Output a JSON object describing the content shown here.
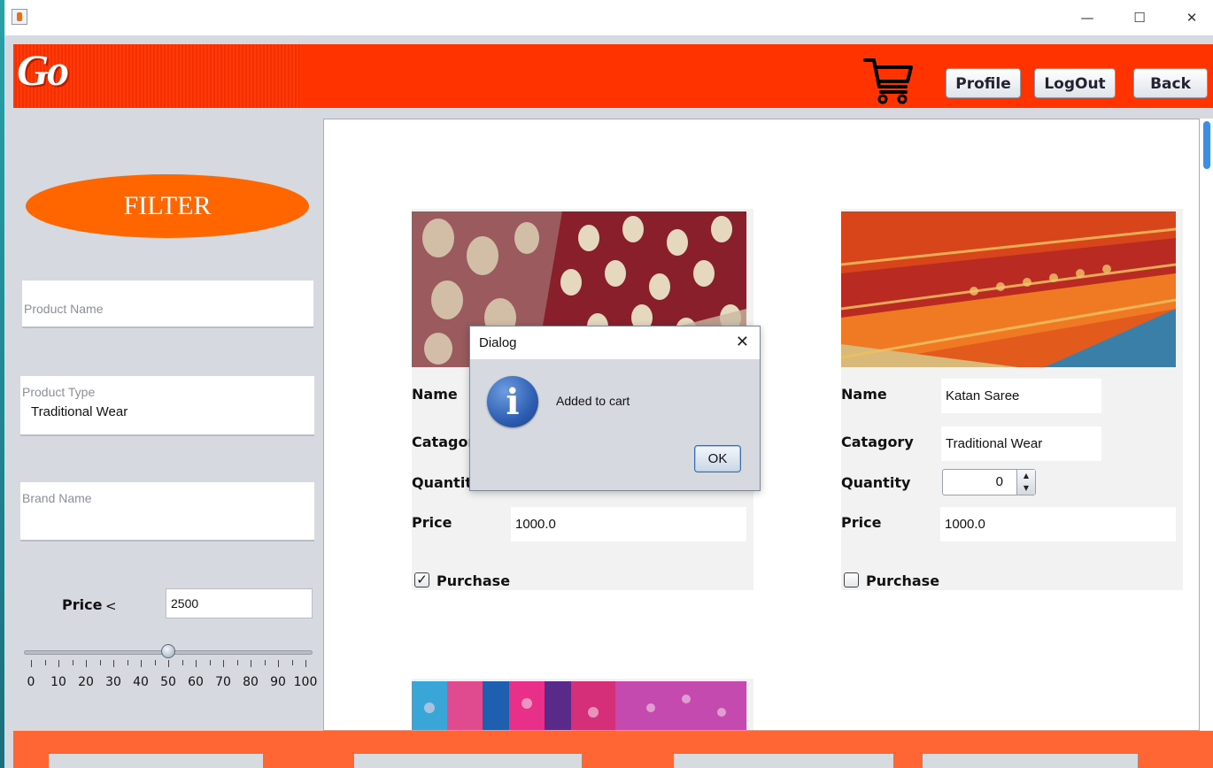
{
  "header": {
    "logo_text": "Go",
    "buttons": {
      "profile": "Profile",
      "logout": "LogOut",
      "back": "Back"
    }
  },
  "window": {
    "minimize": "—",
    "maximize": "☐",
    "close": "✕"
  },
  "sidebar": {
    "filter_title": "FILTER",
    "product_name_placeholder": "Product Name",
    "product_type_placeholder": "Product Type",
    "product_type_value": "Traditional Wear",
    "brand_name_placeholder": "Brand Name",
    "price_label": "Price",
    "price_comparator": "<",
    "price_value": "2500",
    "slider": {
      "value": 50,
      "min": 0,
      "max": 100,
      "major_labels": [
        "0",
        "10",
        "20",
        "30",
        "40",
        "50",
        "60",
        "70",
        "80",
        "90",
        "100"
      ]
    }
  },
  "products": [
    {
      "name_label": "Name",
      "name": "",
      "category_label": "Catagory",
      "category": "",
      "quantity_label": "Quantity",
      "price_label": "Price",
      "price": "1000.0",
      "purchase_label": "Purchase",
      "purchased": true
    },
    {
      "name_label": "Name",
      "name": "Katan Saree",
      "category_label": "Catagory",
      "category": "Traditional Wear",
      "quantity_label": "Quantity",
      "quantity": "0",
      "price_label": "Price",
      "price": "1000.0",
      "purchase_label": "Purchase",
      "purchased": false
    }
  ],
  "dialog": {
    "title": "Dialog",
    "close": "✕",
    "icon": "info-icon",
    "icon_glyph": "i",
    "message": "Added to cart",
    "ok_label": "OK"
  },
  "colors": {
    "header": "#ff3300",
    "filter_pill": "#ff6600",
    "footer": "#ff6633",
    "scrollbar": "#3d8ee8"
  }
}
